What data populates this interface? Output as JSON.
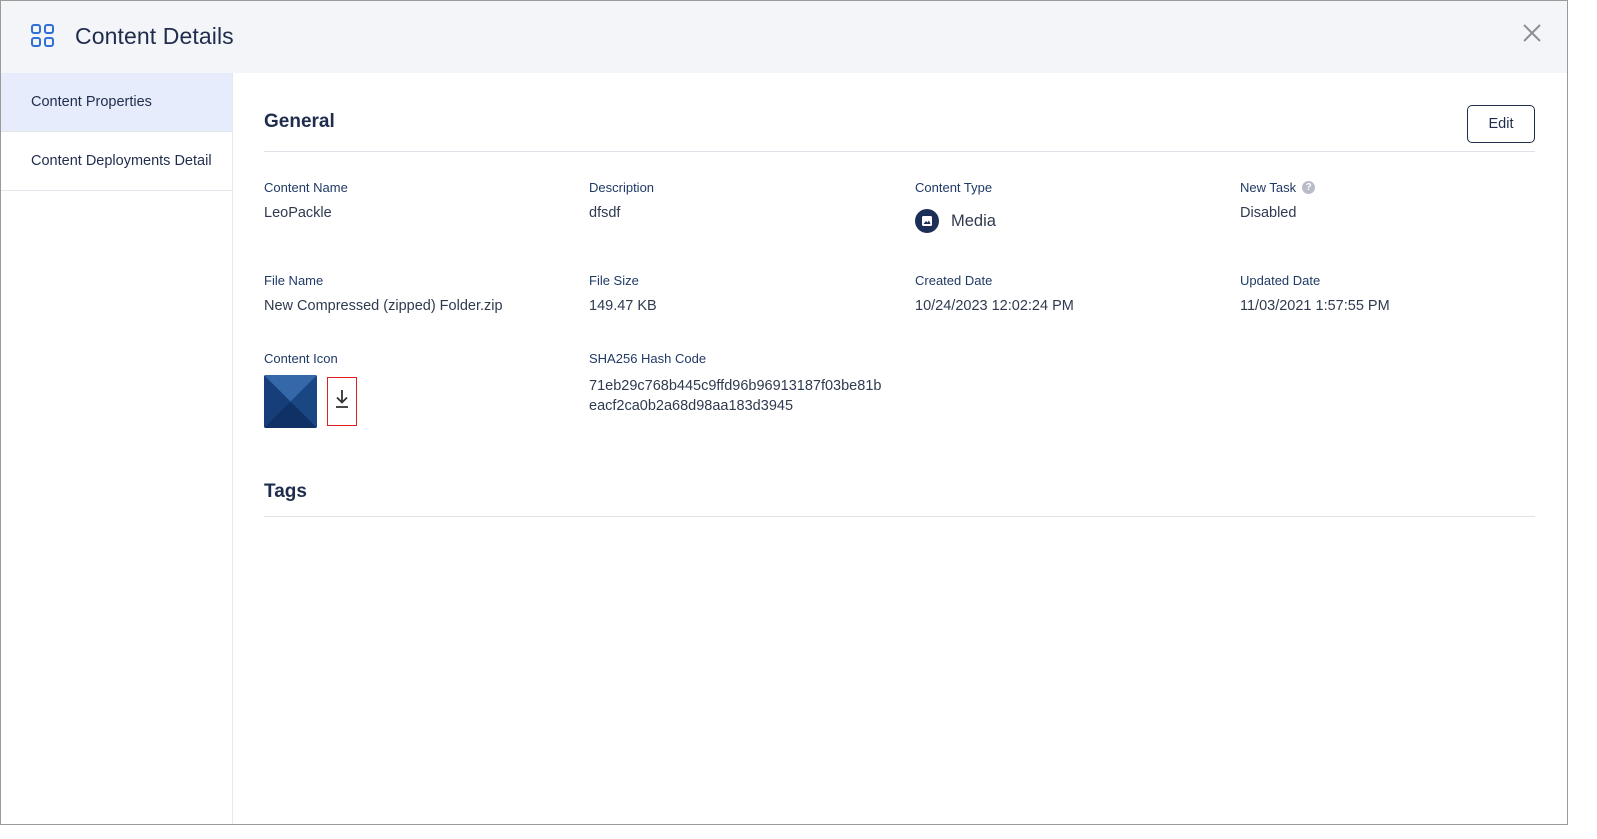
{
  "header": {
    "title": "Content Details"
  },
  "sidebar": {
    "items": [
      {
        "label": "Content Properties",
        "active": true
      },
      {
        "label": "Content Deployments Detail",
        "active": false
      }
    ]
  },
  "general": {
    "title": "General",
    "edit_label": "Edit"
  },
  "fields": {
    "content_name": {
      "label": "Content Name",
      "value": "LeoPackle"
    },
    "description": {
      "label": "Description",
      "value": "dfsdf"
    },
    "content_type": {
      "label": "Content Type",
      "value": "Media"
    },
    "new_task": {
      "label": "New Task",
      "help": "?",
      "value": "Disabled"
    },
    "file_name": {
      "label": "File Name",
      "value": "New Compressed (zipped) Folder.zip"
    },
    "file_size": {
      "label": "File Size",
      "value": "149.47 KB"
    },
    "created_date": {
      "label": "Created Date",
      "value": "10/24/2023 12:02:24 PM"
    },
    "updated_date": {
      "label": "Updated Date",
      "value": "11/03/2021 1:57:55 PM"
    },
    "content_icon": {
      "label": "Content Icon"
    },
    "sha256": {
      "label": "SHA256 Hash Code",
      "line1": "71eb29c768b445c9ffd96b96913187f03be81b",
      "line2": "eacf2ca0b2a68d98aa183d3945"
    }
  },
  "tags": {
    "title": "Tags"
  },
  "colors": {
    "accent_blue": "#2f6fd6",
    "navy": "#1f2d4d",
    "highlight_red": "#e02020",
    "active_sidebar_bg": "#e6ecfb"
  },
  "icons": {
    "header": "grid-icon",
    "close": "close-icon",
    "content_type": "media-icon",
    "help": "help-icon",
    "download": "download-icon"
  }
}
